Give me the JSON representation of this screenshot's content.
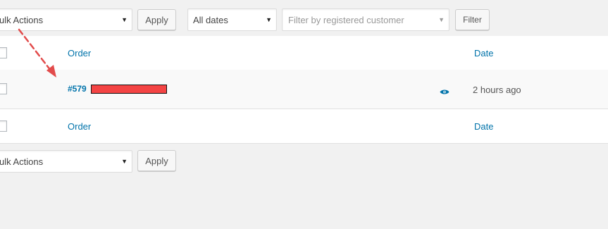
{
  "top_nav": {
    "bulk_actions_value": "ulk Actions",
    "apply_label": "Apply",
    "dates_value": "All dates",
    "customer_placeholder": "Filter by registered customer",
    "filter_label": "Filter"
  },
  "table": {
    "columns": {
      "order": "Order",
      "date": "Date"
    },
    "row": {
      "order_number": "#579",
      "date": "2 hours ago",
      "preview_icon": "eye-icon"
    }
  },
  "bottom_nav": {
    "bulk_actions_value": "ulk Actions",
    "apply_label": "Apply"
  },
  "colors": {
    "link": "#0073aa",
    "redaction": "#f44444",
    "annotation_arrow": "#e24b4b"
  }
}
